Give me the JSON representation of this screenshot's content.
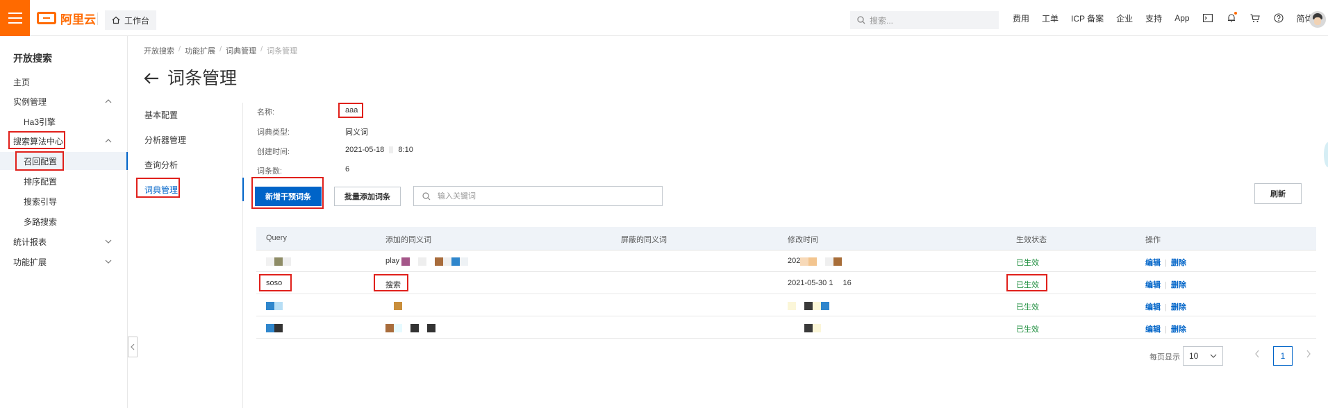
{
  "topbar": {
    "logo_text": "阿里云",
    "workbench": "工作台",
    "search_placeholder": "搜索...",
    "nav": [
      "费用",
      "工单",
      "ICP 备案",
      "企业",
      "支持",
      "App"
    ],
    "lang": "简体",
    "brand_color": "#ff6a00"
  },
  "sidebar": {
    "title": "开放搜索",
    "items": [
      {
        "label": "主页"
      },
      {
        "label": "实例管理"
      },
      {
        "label": "Ha3引擎"
      },
      {
        "label": "搜索算法中心"
      },
      {
        "label": "召回配置"
      },
      {
        "label": "排序配置"
      },
      {
        "label": "搜索引导"
      },
      {
        "label": "多路搜索"
      },
      {
        "label": "统计报表"
      },
      {
        "label": "功能扩展"
      }
    ]
  },
  "breadcrumb": [
    "开放搜索",
    "功能扩展",
    "词典管理",
    "词条管理"
  ],
  "page_title": "词条管理",
  "subnav": [
    "基本配置",
    "分析器管理",
    "查询分析",
    "词典管理"
  ],
  "info": {
    "name_label": "名称:",
    "name_value": "aaa",
    "type_label": "词典类型:",
    "type_value": "同义词",
    "created_label": "创建时间:",
    "created_value_a": "2021-05-18",
    "created_value_b": "8:10",
    "count_label": "词条数:",
    "count_value": "6"
  },
  "actions": {
    "add_intervention": "新增干预词条",
    "batch_add": "批量添加词条",
    "keyword_placeholder": "输入关键词",
    "refresh": "刷新"
  },
  "table": {
    "headers": [
      "Query",
      "添加的同义词",
      "屏蔽的同义词",
      "修改时间",
      "生效状态",
      "操作"
    ],
    "rows": [
      {
        "query": "",
        "synonym": "play",
        "blocked": "",
        "time": "202",
        "status": "已生效"
      },
      {
        "query": "soso",
        "synonym": "搜索",
        "blocked": "",
        "time": "2021-05-30 1",
        "time_b": "16",
        "status": "已生效"
      },
      {
        "query": "",
        "synonym": "",
        "blocked": "",
        "time": "",
        "status": "已生效"
      },
      {
        "query": "",
        "synonym": "",
        "blocked": "",
        "time": "",
        "status": "已生效"
      }
    ],
    "edit": "编辑",
    "delete": "删除"
  },
  "pagination": {
    "per_page_label": "每页显示",
    "per_page": "10",
    "current_page": "1"
  }
}
